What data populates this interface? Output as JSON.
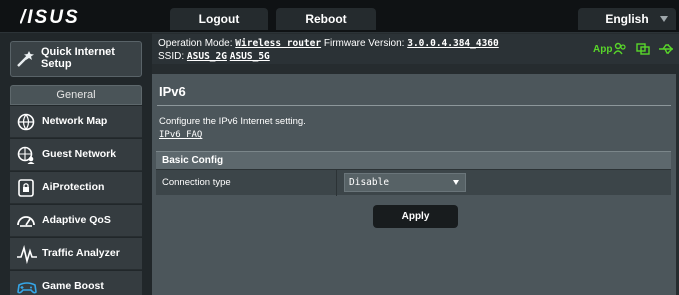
{
  "brand": "/ISUS",
  "header": {
    "logout_label": "Logout",
    "reboot_label": "Reboot",
    "language_label": "English"
  },
  "info": {
    "operation_mode_label": "Operation Mode:",
    "operation_mode_value": "Wireless router",
    "firmware_label": "Firmware Version:",
    "firmware_value": "3.0.0.4.384_4360",
    "ssid_label": "SSID:",
    "ssid_2g": "ASUS_2G",
    "ssid_5g": "ASUS_5G",
    "app_label": "App",
    "status_color": "#59d62a"
  },
  "sidebar": {
    "quick_setup_label": "Quick Internet Setup",
    "section_label": "General",
    "items": [
      {
        "label": "Network Map",
        "icon": "network-map-icon"
      },
      {
        "label": "Guest Network",
        "icon": "guest-network-icon"
      },
      {
        "label": "AiProtection",
        "icon": "lock-icon"
      },
      {
        "label": "Adaptive QoS",
        "icon": "gauge-icon"
      },
      {
        "label": "Traffic Analyzer",
        "icon": "traffic-analyzer-icon"
      },
      {
        "label": "Game Boost",
        "icon": "gamepad-icon"
      }
    ]
  },
  "main": {
    "title": "IPv6",
    "description": "Configure the IPv6 Internet setting.",
    "faq_link": "IPv6 FAQ",
    "section_header": "Basic Config",
    "connection_type_label": "Connection type",
    "connection_type_value": "Disable",
    "apply_label": "Apply"
  }
}
